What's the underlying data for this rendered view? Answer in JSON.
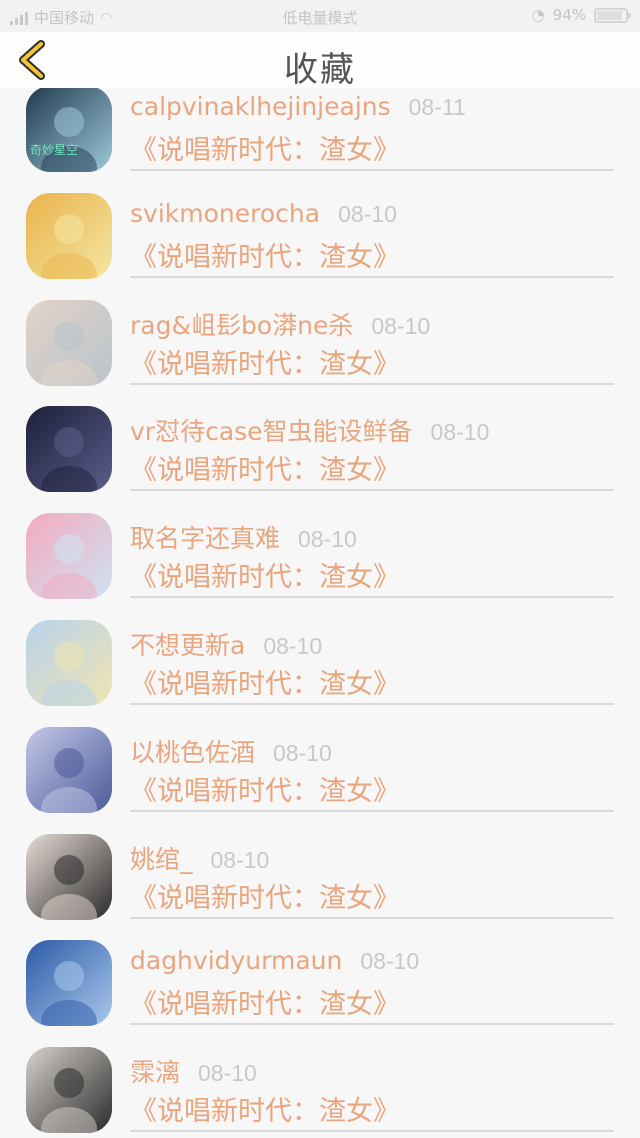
{
  "status_bar": {
    "carrier": "中国移动",
    "center_text": "低电量模式",
    "battery_percent": "94%"
  },
  "nav": {
    "title": "收藏"
  },
  "items": [
    {
      "name": "calpvinaklhejinjeajns",
      "date": "08-11",
      "song": "《说唱新时代：渣女》",
      "avatar_label": "奇妙星空",
      "colors": [
        "#1f3a4e",
        "#9ec9d8"
      ]
    },
    {
      "name": "svikmonerocha",
      "date": "08-10",
      "song": "《说唱新时代：渣女》",
      "colors": [
        "#e9b34a",
        "#f4e6a3"
      ]
    },
    {
      "name": "rag&岨髟bo漭ne杀",
      "date": "08-10",
      "song": "《说唱新时代：渣女》",
      "colors": [
        "#e3d3c8",
        "#b9c3cc"
      ]
    },
    {
      "name": "vr怼待case智虫能设鲜备",
      "date": "08-10",
      "song": "《说唱新时代：渣女》",
      "colors": [
        "#1c1f3a",
        "#5b5e8a"
      ]
    },
    {
      "name": "取名字还真难",
      "date": "08-10",
      "song": "《说唱新时代：渣女》",
      "colors": [
        "#f5a9bf",
        "#cde3f2"
      ]
    },
    {
      "name": "不想更新a",
      "date": "08-10",
      "song": "《说唱新时代：渣女》",
      "colors": [
        "#b7d2ee",
        "#f0e4b0"
      ]
    },
    {
      "name": "以桃色佐酒",
      "date": "08-10",
      "song": "《说唱新时代：渣女》",
      "colors": [
        "#c4c9e8",
        "#4b5a99"
      ]
    },
    {
      "name": "姚绾_",
      "date": "08-10",
      "song": "《说唱新时代：渣女》",
      "colors": [
        "#e7dcd6",
        "#2a2a2a"
      ]
    },
    {
      "name": "daghvidyurmaun",
      "date": "08-10",
      "song": "《说唱新时代：渣女》",
      "colors": [
        "#2c5aa8",
        "#a9c8ea"
      ]
    },
    {
      "name": "霂漓",
      "date": "08-10",
      "song": "《说唱新时代：渣女》",
      "colors": [
        "#d7d2cc",
        "#2b2b2b"
      ]
    }
  ]
}
